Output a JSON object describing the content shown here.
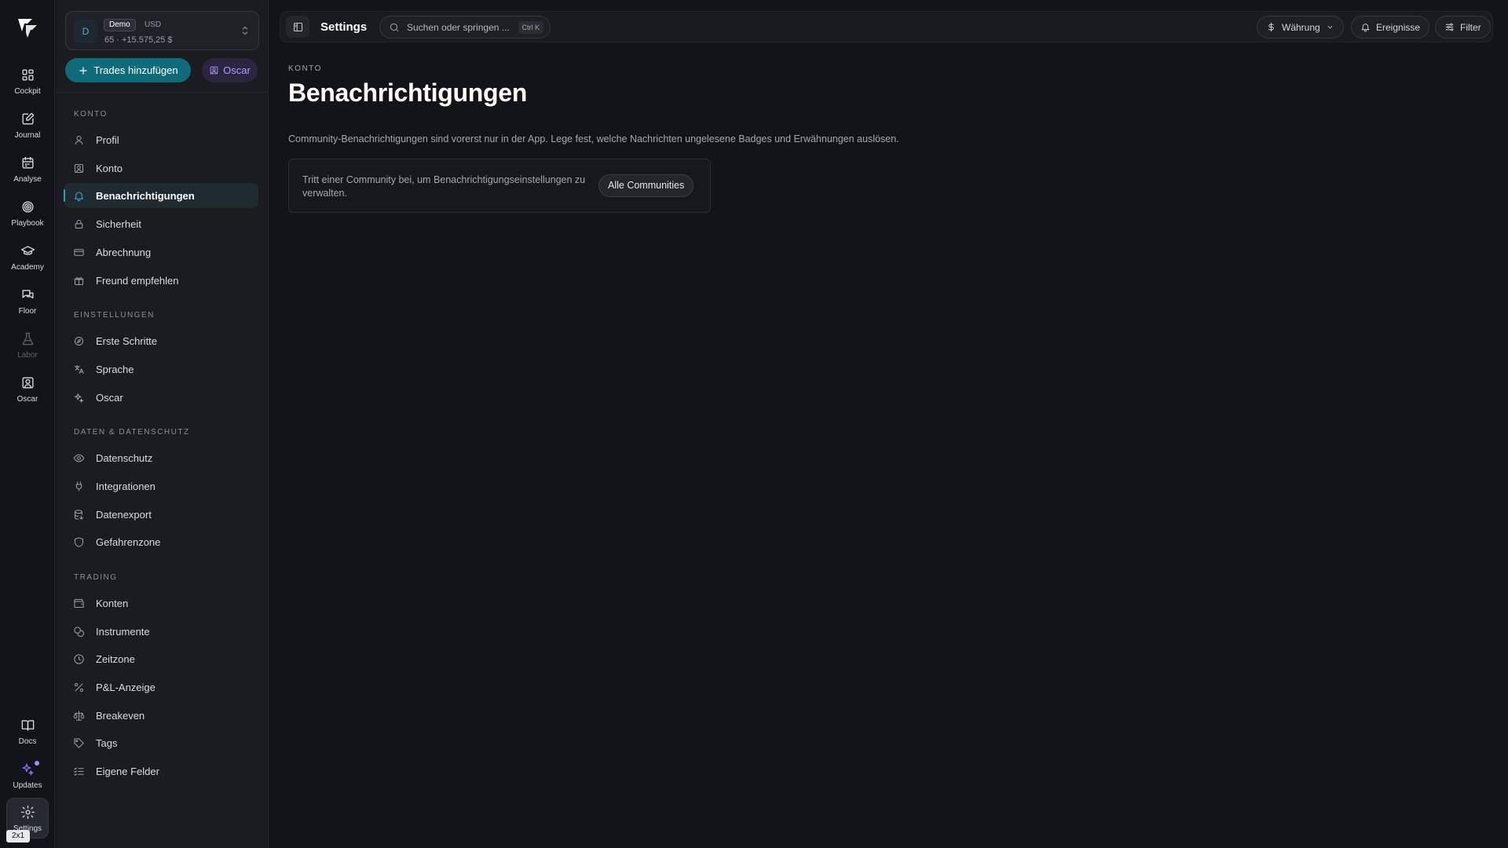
{
  "rail": {
    "items": [
      {
        "label": "Cockpit",
        "icon": "grid-icon"
      },
      {
        "label": "Journal",
        "icon": "edit-icon"
      },
      {
        "label": "Analyse",
        "icon": "calendar-icon"
      },
      {
        "label": "Playbook",
        "icon": "target-icon"
      },
      {
        "label": "Academy",
        "icon": "graduation-cap-icon"
      },
      {
        "label": "Floor",
        "icon": "chat-icon"
      },
      {
        "label": "Labor",
        "icon": "flask-icon"
      },
      {
        "label": "Oscar",
        "icon": "user-square-icon"
      }
    ],
    "bottom": [
      {
        "label": "Docs",
        "icon": "book-icon"
      },
      {
        "label": "Updates",
        "icon": "sparkles-icon"
      },
      {
        "label": "Settings",
        "icon": "gear-icon"
      }
    ],
    "zoom_badge": "2x1"
  },
  "account": {
    "avatar": "D",
    "badge": "Demo",
    "currency": "USD",
    "summary": "65 · +15.575,25 $"
  },
  "actions": {
    "add_trades": "Trades hinzufügen",
    "oscar": "Oscar"
  },
  "nav": {
    "sections": [
      {
        "title": "KONTO",
        "items": [
          "Profil",
          "Konto",
          "Benachrichtigungen",
          "Sicherheit",
          "Abrechnung",
          "Freund empfehlen"
        ]
      },
      {
        "title": "EINSTELLUNGEN",
        "items": [
          "Erste Schritte",
          "Sprache",
          "Oscar"
        ]
      },
      {
        "title": "DATEN & DATENSCHUTZ",
        "items": [
          "Datenschutz",
          "Integrationen",
          "Datenexport",
          "Gefahrenzone"
        ]
      },
      {
        "title": "TRADING",
        "items": [
          "Konten",
          "Instrumente",
          "Zeitzone",
          "P&L-Anzeige",
          "Breakeven",
          "Tags",
          "Eigene Felder"
        ]
      }
    ],
    "active": "Benachrichtigungen"
  },
  "topbar": {
    "title": "Settings",
    "search_placeholder": "Suchen oder springen ...",
    "shortcut": "Ctrl K",
    "currency": "Währung",
    "events": "Ereignisse",
    "filter": "Filter"
  },
  "page": {
    "kicker": "KONTO",
    "title": "Benachrichtigungen",
    "description": "Community-Benachrichtigungen sind vorerst nur in der App. Lege fest, welche Nachrichten ungelesene Badges und Erwähnungen auslösen.",
    "card_text": "Tritt einer Community bei, um Benachrichtigungseinstellungen zu verwalten.",
    "card_button": "Alle Communities"
  },
  "colors": {
    "accent": "#0f6b7a",
    "active_indicator": "#19a7bd",
    "oscar_purple": "#b49cff",
    "background": "#131417"
  }
}
